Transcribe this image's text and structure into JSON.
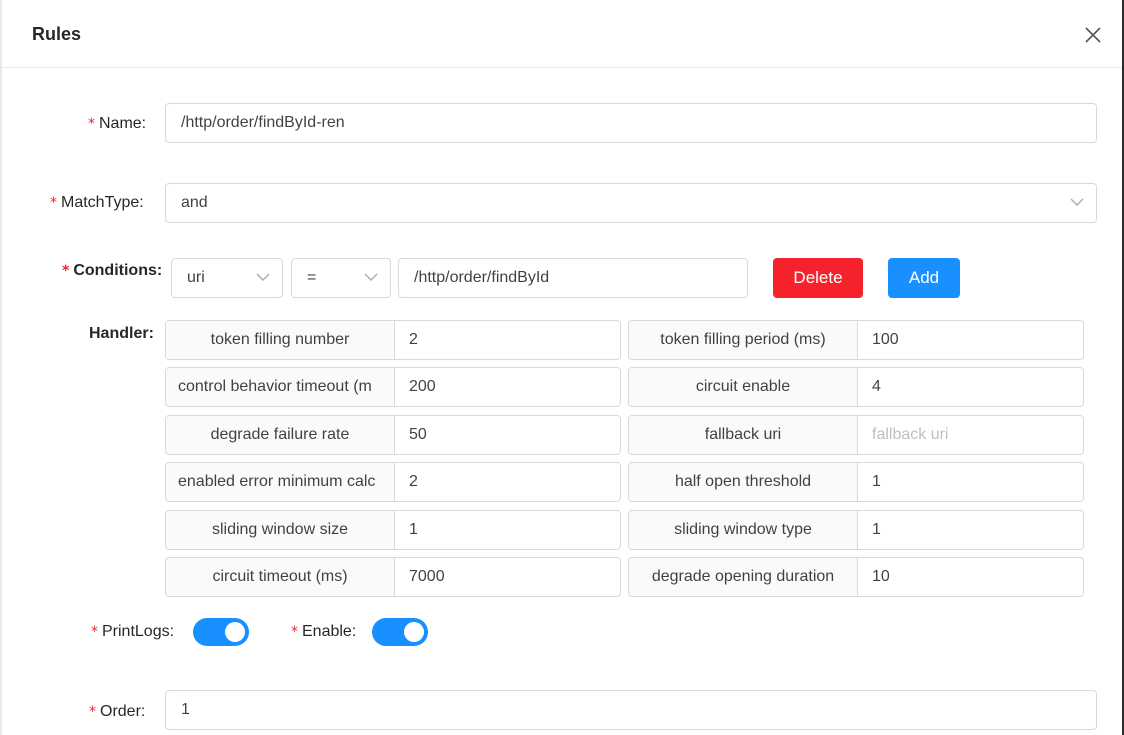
{
  "modal": {
    "title": "Rules"
  },
  "form": {
    "name": {
      "label": "Name:",
      "value": "/http/order/findById-ren"
    },
    "match_type": {
      "label": "MatchType:",
      "value": "and"
    },
    "conditions": {
      "label": "Conditions:",
      "param_type": "uri",
      "operator": "=",
      "value": "/http/order/findById",
      "delete_label": "Delete",
      "add_label": "Add"
    },
    "handler": {
      "label": "Handler:",
      "fields": [
        {
          "label": "token filling number",
          "value": "2",
          "placeholder": ""
        },
        {
          "label": "token filling period (ms)",
          "value": "100",
          "placeholder": ""
        },
        {
          "label": "control behavior timeout (m",
          "value": "200",
          "placeholder": ""
        },
        {
          "label": "circuit enable",
          "value": "4",
          "placeholder": ""
        },
        {
          "label": "degrade failure rate",
          "value": "50",
          "placeholder": ""
        },
        {
          "label": "fallback uri",
          "value": "",
          "placeholder": "fallback uri"
        },
        {
          "label": "enabled error minimum calc",
          "value": "2",
          "placeholder": ""
        },
        {
          "label": "half open threshold",
          "value": "1",
          "placeholder": ""
        },
        {
          "label": "sliding window size",
          "value": "1",
          "placeholder": ""
        },
        {
          "label": "sliding window type",
          "value": "1",
          "placeholder": ""
        },
        {
          "label": "circuit timeout (ms)",
          "value": "7000",
          "placeholder": ""
        },
        {
          "label": "degrade opening duration",
          "value": "10",
          "placeholder": ""
        }
      ]
    },
    "print_logs": {
      "label": "PrintLogs:",
      "on": true
    },
    "enable": {
      "label": "Enable:",
      "on": true
    },
    "order": {
      "label": "Order:",
      "value": "1"
    }
  },
  "colors": {
    "primary": "#1890ff",
    "danger": "#f5222d",
    "required": "#f5222d",
    "border": "#d9d9d9"
  },
  "icons": {
    "close": "close-icon",
    "select": "chevron-down-icon"
  }
}
